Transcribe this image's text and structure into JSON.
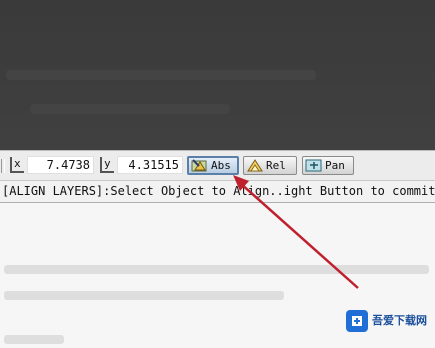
{
  "coordinates": {
    "x_axis_label": "x",
    "x_value": "7.4738",
    "y_axis_label": "y",
    "y_value": "4.31515"
  },
  "mode_buttons": {
    "abs_label": "Abs",
    "rel_label": "Rel",
    "pan_label": "Pan",
    "active": "Abs"
  },
  "status_bar": {
    "prompt": "[ALIGN LAYERS]:Select Object to Align..ight Button to commit, Twice"
  },
  "watermark": {
    "brand": "吾爱下载网"
  },
  "colors": {
    "annotation_arrow": "#c0202e",
    "active_button_border": "#5a7fa8"
  },
  "icons": {
    "abs": "align-absolute-icon",
    "rel": "align-relative-icon",
    "pan": "pan-icon"
  }
}
